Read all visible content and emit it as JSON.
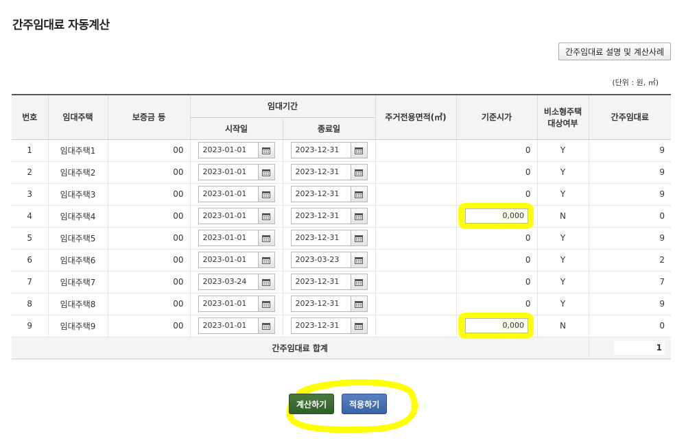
{
  "page": {
    "title": "간주임대료 자동계산"
  },
  "toolbar": {
    "description_button": "간주임대료 설명 및 계산사례"
  },
  "unit_note": "(단위 : 원, ㎡)",
  "colors": {
    "highlight": "#ffff00",
    "primary_button": "#3a63a5",
    "header_bg": "#f4f4f4"
  },
  "table": {
    "headers": {
      "no": "번호",
      "house": "임대주택",
      "deposit": "보증금 등",
      "period": "임대기간",
      "start": "시작일",
      "end": "종료일",
      "area": "주거전용면적(㎡)",
      "base_price": "기준시가",
      "small_house_1": "비소형주택",
      "small_house_2": "대상여부",
      "deemed_rent": "간주임대료"
    },
    "rows": [
      {
        "no": "1",
        "name": "임대주택1",
        "deposit": "00",
        "start": "2023-01-01",
        "end": "2023-12-31",
        "area": "",
        "base_price": "0",
        "flag": "Y",
        "rent": "9"
      },
      {
        "no": "2",
        "name": "임대주택2",
        "deposit": "00",
        "start": "2023-01-01",
        "end": "2023-12-31",
        "area": "",
        "base_price": "0",
        "flag": "Y",
        "rent": "9"
      },
      {
        "no": "3",
        "name": "임대주택3",
        "deposit": "00",
        "start": "2023-01-01",
        "end": "2023-12-31",
        "area": "",
        "base_price": "0",
        "flag": "Y",
        "rent": "9"
      },
      {
        "no": "4",
        "name": "임대주택4",
        "deposit": "00",
        "start": "2023-01-01",
        "end": "2023-12-31",
        "area": "",
        "base_price": "0,000",
        "flag": "N",
        "rent": "0"
      },
      {
        "no": "5",
        "name": "임대주택5",
        "deposit": "00",
        "start": "2023-01-01",
        "end": "2023-12-31",
        "area": "",
        "base_price": "0",
        "flag": "Y",
        "rent": "9"
      },
      {
        "no": "6",
        "name": "임대주택6",
        "deposit": "00",
        "start": "2023-01-01",
        "end": "2023-03-23",
        "area": "",
        "base_price": "0",
        "flag": "Y",
        "rent": "2"
      },
      {
        "no": "7",
        "name": "임대주택7",
        "deposit": "00",
        "start": "2023-03-24",
        "end": "2023-12-31",
        "area": "",
        "base_price": "0",
        "flag": "Y",
        "rent": "7"
      },
      {
        "no": "8",
        "name": "임대주택8",
        "deposit": "00",
        "start": "2023-01-01",
        "end": "2023-12-31",
        "area": "",
        "base_price": "0",
        "flag": "Y",
        "rent": "9"
      },
      {
        "no": "9",
        "name": "임대주택9",
        "deposit": "00",
        "start": "2023-01-01",
        "end": "2023-12-31",
        "area": "",
        "base_price": "0,000",
        "flag": "N",
        "rent": "0"
      }
    ],
    "sum_label": "간주임대료 합계",
    "sum_value": "1"
  },
  "actions": {
    "calculate": "계산하기",
    "apply": "적용하기"
  },
  "icons": {
    "calendar": "calendar-icon"
  }
}
